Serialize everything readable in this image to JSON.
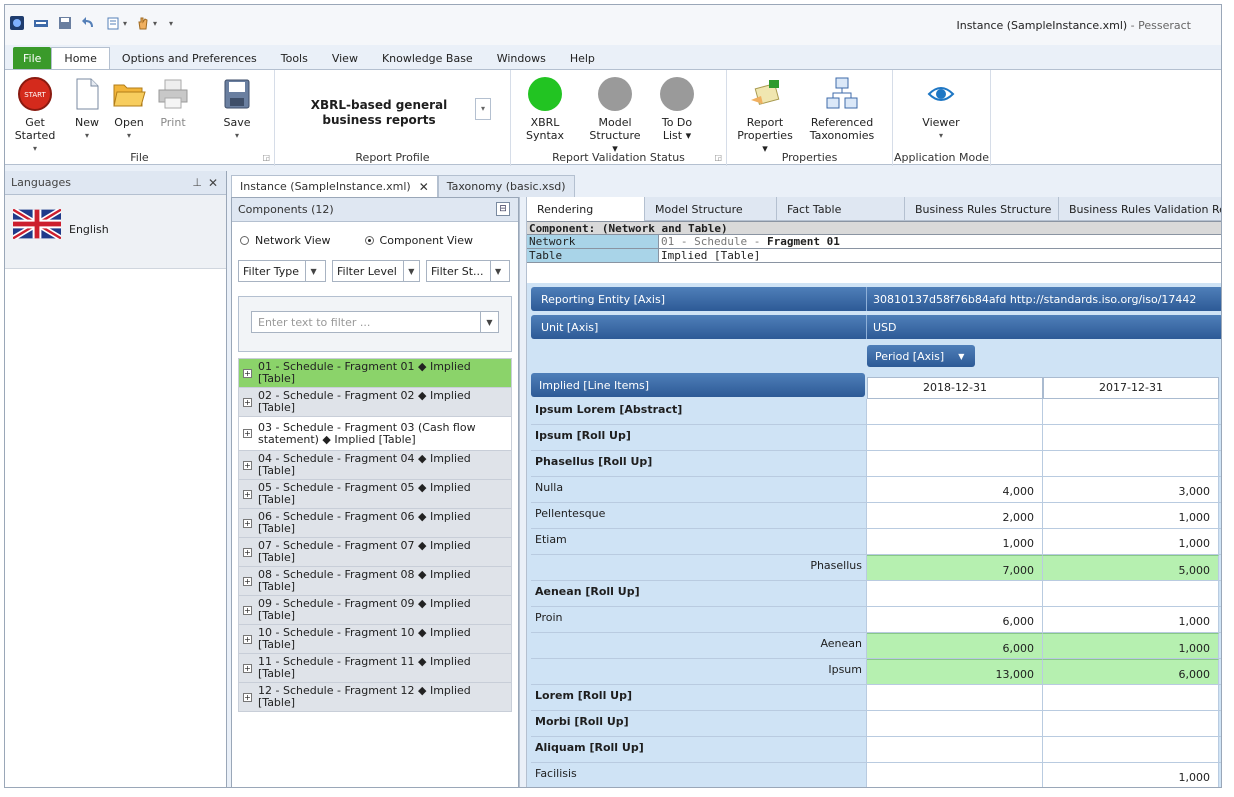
{
  "window": {
    "title": "Instance (SampleInstance.xml)",
    "app_name": " - Pesseract"
  },
  "ribbon_tabs": [
    "File",
    "Home",
    "Options and Preferences",
    "Tools",
    "View",
    "Knowledge Base",
    "Windows",
    "Help"
  ],
  "ribbon": {
    "file_group": {
      "label": "File",
      "get_started": "Get Started",
      "new": "New",
      "open": "Open",
      "print": "Print",
      "save": "Save"
    },
    "report_profile": {
      "label": "Report Profile",
      "value": "XBRL-based general business reports"
    },
    "validation": {
      "label": "Report Validation Status",
      "xbrl_syntax": "XBRL Syntax",
      "model_structure": "Model Structure",
      "todo_list": "To Do List"
    },
    "properties": {
      "label": "Properties",
      "report_properties": "Report Properties",
      "referenced_taxonomies": "Referenced Taxonomies"
    },
    "app_mode": {
      "label": "Application Mode",
      "viewer": "Viewer"
    },
    "start_badge": "START"
  },
  "languages_panel": {
    "title": "Languages",
    "item": "English"
  },
  "doc_tabs": [
    "Instance (SampleInstance.xml)",
    "Taxonomy (basic.xsd)"
  ],
  "components": {
    "title": "Components (12)",
    "network_view": "Network View",
    "component_view": "Component View",
    "filters": [
      "Filter Type",
      "Filter Level",
      "Filter St..."
    ],
    "filter_placeholder": "Enter text to filter ...",
    "items": [
      "01 - Schedule - Fragment 01 ◆ Implied [Table]",
      "02 - Schedule - Fragment 02 ◆ Implied [Table]",
      "03 - Schedule - Fragment 03 (Cash flow statement) ◆ Implied [Table]",
      "04 - Schedule - Fragment 04 ◆ Implied [Table]",
      "05 - Schedule - Fragment 05 ◆ Implied [Table]",
      "06 - Schedule - Fragment 06 ◆ Implied [Table]",
      "07 - Schedule - Fragment 07 ◆ Implied [Table]",
      "08 - Schedule - Fragment 08 ◆ Implied [Table]",
      "09 - Schedule - Fragment 09 ◆ Implied [Table]",
      "10 - Schedule - Fragment 10 ◆ Implied [Table]",
      "11 - Schedule - Fragment 11 ◆ Implied [Table]",
      "12 - Schedule - Fragment 12 ◆ Implied [Table]"
    ]
  },
  "render_tabs": [
    "Rendering",
    "Model Structure",
    "Fact Table",
    "Business Rules Structure",
    "Business Rules Validation Re"
  ],
  "meta": {
    "title": "Component: (Network and Table)",
    "network_key": "Network",
    "network_prefix": "01 - Schedule - ",
    "network_value": "Fragment 01",
    "table_key": "Table",
    "table_value": "Implied [Table]"
  },
  "grid": {
    "entity_label": "Reporting Entity [Axis]",
    "entity_value": "30810137d58f76b84afd http://standards.iso.org/iso/17442",
    "unit_label": "Unit [Axis]",
    "unit_value": "USD",
    "period_label": "Period [Axis]",
    "line_items": "Implied [Line Items]",
    "columns": [
      "2018-12-31",
      "2017-12-31"
    ],
    "rows": [
      {
        "label": "Ipsum Lorem [Abstract]",
        "style": "bold",
        "v1": "",
        "v2": ""
      },
      {
        "label": "Ipsum [Roll Up]",
        "style": "bold",
        "v1": "",
        "v2": ""
      },
      {
        "label": "Phasellus [Roll Up]",
        "style": "bold",
        "v1": "",
        "v2": ""
      },
      {
        "label": "Nulla",
        "style": "",
        "v1": "4,000",
        "v2": "3,000"
      },
      {
        "label": "Pellentesque",
        "style": "",
        "v1": "2,000",
        "v2": "1,000"
      },
      {
        "label": "Etiam",
        "style": "",
        "v1": "1,000",
        "v2": "1,000"
      },
      {
        "label": "Phasellus",
        "style": "total",
        "v1": "7,000",
        "v2": "5,000"
      },
      {
        "label": "Aenean [Roll Up]",
        "style": "bold",
        "v1": "",
        "v2": ""
      },
      {
        "label": "Proin",
        "style": "",
        "v1": "6,000",
        "v2": "1,000"
      },
      {
        "label": "Aenean",
        "style": "total",
        "v1": "6,000",
        "v2": "1,000"
      },
      {
        "label": "Ipsum",
        "style": "total",
        "v1": "13,000",
        "v2": "6,000"
      },
      {
        "label": "Lorem [Roll Up]",
        "style": "bold",
        "v1": "",
        "v2": ""
      },
      {
        "label": "Morbi [Roll Up]",
        "style": "bold",
        "v1": "",
        "v2": ""
      },
      {
        "label": "Aliquam [Roll Up]",
        "style": "bold",
        "v1": "",
        "v2": ""
      },
      {
        "label": "Facilisis",
        "style": "",
        "v1": "",
        "v2": "1,000"
      }
    ]
  },
  "colors": {
    "file_tab": "#3a9a2a",
    "selected_component": "#8bd36a",
    "total_cell": "#b6f0b0",
    "axis_bar": "#2d5a96",
    "status_ok": "#22c422",
    "status_gray": "#9a9a9a"
  }
}
